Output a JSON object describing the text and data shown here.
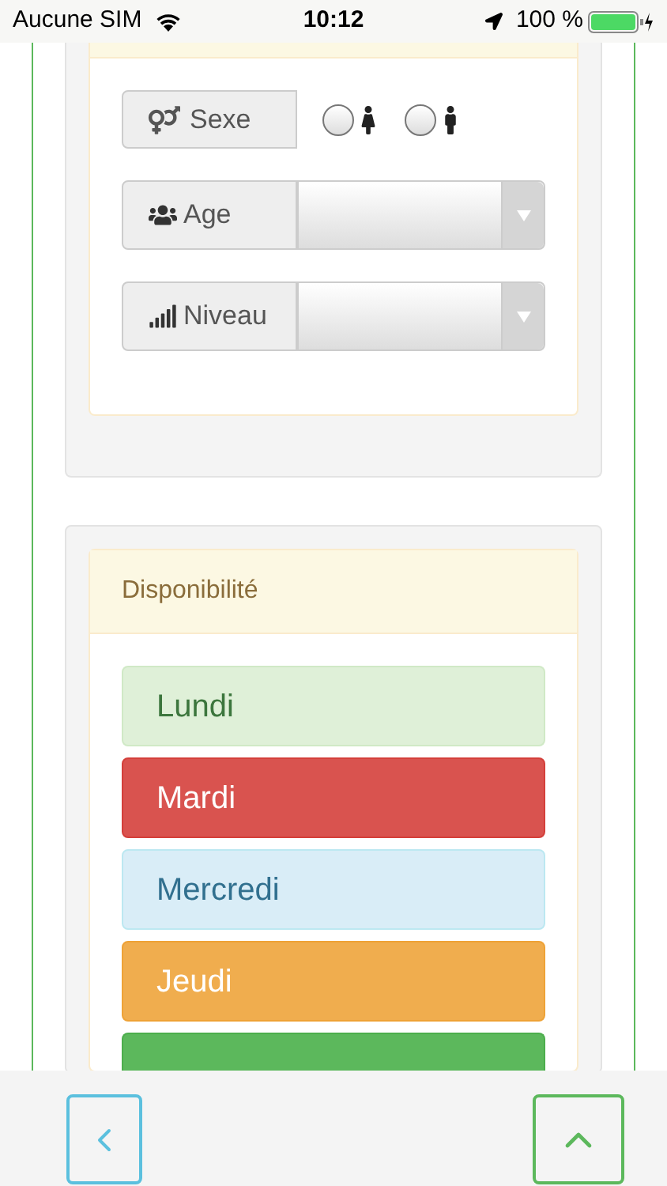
{
  "status_bar": {
    "carrier": "Aucune SIM",
    "time": "10:12",
    "battery": "100 %"
  },
  "profile_form": {
    "sexe": {
      "label": "Sexe",
      "options": [
        {
          "kind": "female",
          "selected": false
        },
        {
          "kind": "male",
          "selected": false
        }
      ]
    },
    "fields": [
      {
        "kind": "age",
        "label": "Age"
      },
      {
        "kind": "level",
        "label": "Niveau"
      }
    ]
  },
  "availability": {
    "title": "Disponibilité",
    "days": [
      {
        "label": "Lundi",
        "kind": "success-light"
      },
      {
        "label": "Mardi",
        "kind": "danger"
      },
      {
        "label": "Mercredi",
        "kind": "info-light"
      },
      {
        "label": "Jeudi",
        "kind": "warning"
      },
      {
        "kind": "success"
      }
    ]
  }
}
